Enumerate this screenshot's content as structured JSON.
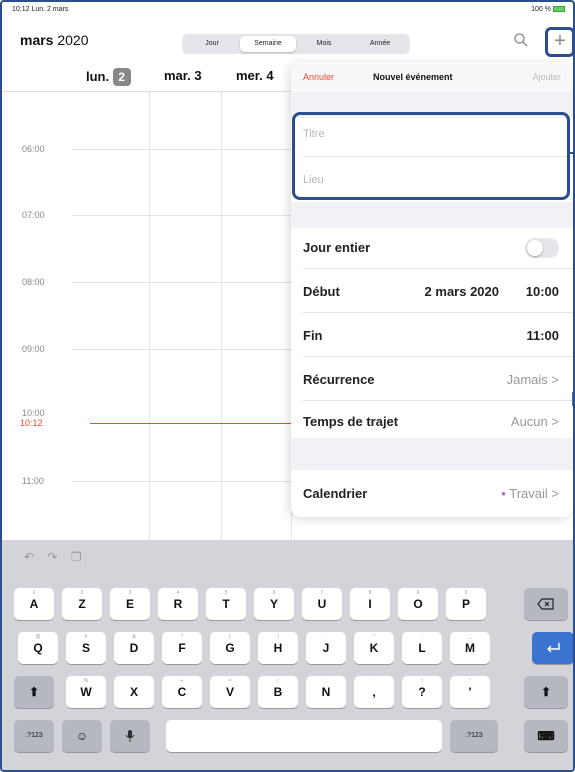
{
  "status": {
    "left": "10:12  Lun. 2 mars",
    "right": "100 %"
  },
  "header": {
    "month_bold": "mars",
    "month_year": " 2020",
    "segments": [
      "Jour",
      "Semaine",
      "Mois",
      "Année"
    ],
    "active_segment": "Semaine",
    "plus": "+"
  },
  "days": [
    {
      "name": "lun.",
      "num": "2"
    },
    {
      "name": "mar.",
      "num": "3"
    },
    {
      "name": "mer.",
      "num": "4"
    }
  ],
  "hours": [
    "06:00",
    "07:00",
    "08:00",
    "09:00",
    "10:00",
    "11:00"
  ],
  "now_label": "10:12",
  "popover": {
    "cancel": "Annuler",
    "title": "Nouvel événement",
    "add": "Ajouter",
    "title_placeholder": "Titre",
    "location_placeholder": "Lieu",
    "all_day_label": "Jour entier",
    "start_label": "Début",
    "start_date": "2 mars 2020",
    "start_time": "10:00",
    "end_label": "Fin",
    "end_time": "11:00",
    "recurrence_label": "Récurrence",
    "recurrence_value": "Jamais",
    "travel_label": "Temps de trajet",
    "travel_value": "Aucun",
    "calendar_label": "Calendrier",
    "calendar_value": "Travail",
    "chevron": ">"
  },
  "keyboard": {
    "row1": [
      {
        "lab": "A",
        "sub": "1"
      },
      {
        "lab": "Z",
        "sub": "2"
      },
      {
        "lab": "E",
        "sub": "3"
      },
      {
        "lab": "R",
        "sub": "4"
      },
      {
        "lab": "T",
        "sub": "5"
      },
      {
        "lab": "Y",
        "sub": "6"
      },
      {
        "lab": "U",
        "sub": "7"
      },
      {
        "lab": "I",
        "sub": "8"
      },
      {
        "lab": "O",
        "sub": "9"
      },
      {
        "lab": "P",
        "sub": "0"
      }
    ],
    "row2": [
      {
        "lab": "Q",
        "sub": "@"
      },
      {
        "lab": "S",
        "sub": "#"
      },
      {
        "lab": "D",
        "sub": "&"
      },
      {
        "lab": "F",
        "sub": "*"
      },
      {
        "lab": "G",
        "sub": "("
      },
      {
        "lab": "H",
        "sub": ")"
      },
      {
        "lab": "J",
        "sub": "'"
      },
      {
        "lab": "K",
        "sub": "\""
      },
      {
        "lab": "L",
        "sub": "-"
      },
      {
        "lab": "M",
        "sub": "_"
      }
    ],
    "row3": [
      {
        "lab": "W",
        "sub": "%"
      },
      {
        "lab": "X",
        "sub": "-"
      },
      {
        "lab": "C",
        "sub": "+"
      },
      {
        "lab": "V",
        "sub": "="
      },
      {
        "lab": "B",
        "sub": "/"
      },
      {
        "lab": "N",
        "sub": ";"
      },
      {
        "lab": ",",
        "sub": ":"
      },
      {
        "lab": "?",
        "sub": "!"
      },
      {
        "lab": "'",
        "sub": "\""
      }
    ],
    "numkey": ".?123",
    "backspace_icon": "backspace-icon",
    "return_icon": "return-icon",
    "shift_icon": "shift-icon"
  },
  "colors": {
    "accent": "#e84a2c",
    "highlight": "#2b4e8c",
    "return_key": "#3a73d0"
  }
}
